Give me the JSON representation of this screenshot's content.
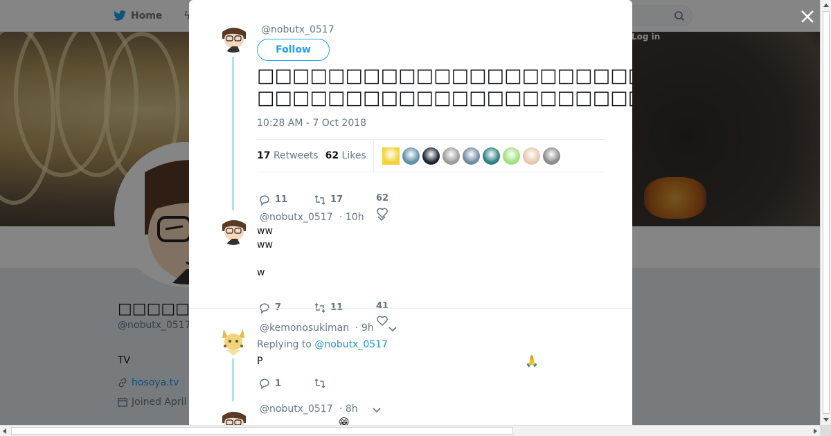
{
  "background": {
    "nav": {
      "home_label": "Home",
      "login_label": "Log in"
    },
    "profile": {
      "name": "□□□□□□□□",
      "handle": "@nobutx_0517",
      "bio": "TV",
      "link": "hosoya.tv",
      "joined": "Joined April"
    }
  },
  "tweet": {
    "handle": "@nobutx_0517",
    "follow_label": "Follow",
    "text": "□□□□□□□□□□□□□□□□□□□□□□□□□□□□□□□□□□□□□□□□□□□□□□□□□□(\n□□□□□□□□□□□□□□□□□□□□□□□□□□□□□□□□□□□□□□□□□□□□□□□□□□",
    "timestamp": "10:28 AM - 7 Oct 2018",
    "retweets_count": "17",
    "retweets_label": "Retweets",
    "likes_count": "62",
    "likes_label": "Likes",
    "likers": [
      {
        "icon": "cheese-avatar",
        "color": "#f2d43a"
      },
      {
        "icon": "user-avatar",
        "color": "#5e8fa6"
      },
      {
        "icon": "user-avatar",
        "color": "#1a2433"
      },
      {
        "icon": "user-avatar",
        "color": "#9a9a9a"
      },
      {
        "icon": "user-avatar",
        "color": "#6f8aa0"
      },
      {
        "icon": "user-avatar",
        "color": "#2e7e7e"
      },
      {
        "icon": "user-avatar",
        "color": "#9ee07a"
      },
      {
        "icon": "user-avatar",
        "color": "#e7c6a9"
      },
      {
        "icon": "user-avatar",
        "color": "#8a8a8a"
      }
    ],
    "replies": "11",
    "retweets": "17",
    "likes": "62"
  },
  "replies": [
    {
      "handle": "@nobutx_0517",
      "time": "· 10h",
      "text": "ww\nww\n\nw",
      "replies": "7",
      "retweets": "11",
      "likes": "41"
    },
    {
      "handle": "@kemonosukiman",
      "time": "· 9h",
      "replying_prefix": "Replying to",
      "replying_to": "@nobutx_0517",
      "text": "P",
      "emoji": "🙏",
      "replies": "1"
    },
    {
      "handle": "@nobutx_0517",
      "time": "· 8h",
      "emoji": "😁"
    }
  ],
  "colors": {
    "accent": "#1da1f2",
    "thread": "#b3dff7",
    "muted": "#657786"
  }
}
